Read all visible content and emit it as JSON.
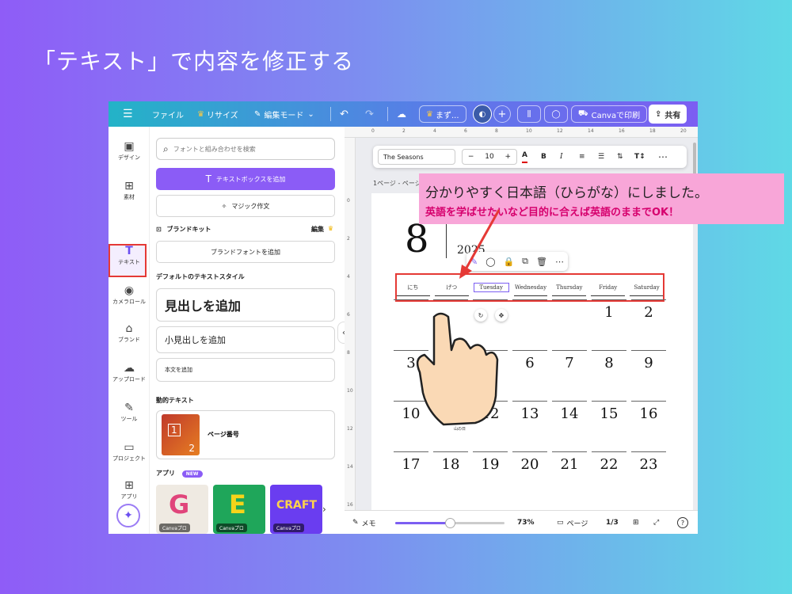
{
  "slide": {
    "title": "「テキスト」で内容を修正する"
  },
  "topbar": {
    "menu_icon": "hamburger-icon",
    "file": "ファイル",
    "resize": "リサイズ",
    "edit_mode": "編集モード",
    "doc_title": "まず...",
    "print": "Canvaで印刷",
    "share": "共有"
  },
  "rail": {
    "items": [
      {
        "label": "デザイン",
        "icon": "design-icon"
      },
      {
        "label": "素材",
        "icon": "elements-icon"
      },
      {
        "label": "テキスト",
        "icon": "text-icon"
      },
      {
        "label": "カメラロール",
        "icon": "camera-icon"
      },
      {
        "label": "ブランド",
        "icon": "brand-icon"
      },
      {
        "label": "アップロード",
        "icon": "upload-icon"
      },
      {
        "label": "ツール",
        "icon": "tools-icon"
      },
      {
        "label": "プロジェクト",
        "icon": "folder-icon"
      },
      {
        "label": "アプリ",
        "icon": "apps-icon"
      }
    ]
  },
  "panel": {
    "search_placeholder": "フォントと組み合わせを検索",
    "add_textbox": "テキストボックスを追加",
    "magic_write": "マジック作文",
    "brand_kit": "ブランドキット",
    "brand_edit": "編集",
    "add_brand_font": "ブランドフォントを追加",
    "default_styles": "デフォルトのテキストスタイル",
    "heading": "見出しを追加",
    "subheading": "小見出しを追加",
    "body": "本文を追加",
    "dynamic_text": "動的テキスト",
    "page_number": "ページ番号",
    "apps": "アプリ",
    "new_badge": "NEW",
    "app_badge": "Canvaプロ",
    "app_tiles": [
      "G",
      "E",
      "CRAFT"
    ]
  },
  "canvas": {
    "ruler_marks": [
      "0",
      "2",
      "4",
      "6",
      "8",
      "10",
      "12",
      "14",
      "16",
      "18",
      "20"
    ],
    "ruler_left": [
      "0",
      "2",
      "4",
      "6",
      "8",
      "10",
      "12",
      "14",
      "16",
      "18"
    ],
    "font": "The Seasons",
    "font_size": "10",
    "page_label": "1ページ - ページ...",
    "month": "8",
    "year": "2025",
    "weekdays": [
      "にち",
      "げつ",
      "Tuesday",
      "Wednesday",
      "Thursday",
      "Friday",
      "Saturday"
    ],
    "days": [
      [
        "",
        "",
        "",
        "",
        "",
        "1",
        "2"
      ],
      [
        "3",
        "",
        "",
        "6",
        "7",
        "8",
        "9"
      ],
      [
        "10",
        "11",
        "12",
        "13",
        "14",
        "15",
        "16"
      ],
      [
        "17",
        "18",
        "19",
        "20",
        "21",
        "22",
        "23"
      ]
    ],
    "holiday_label": "山の日"
  },
  "bottombar": {
    "memo": "メモ",
    "zoom": "73%",
    "zoom_level": 0.5,
    "pages": "ページ",
    "page_count": "1/3"
  },
  "callout": {
    "line1": "分かりやすく日本語（ひらがな）にしました。",
    "line2": "英語を学ばせたいなど目的に合えば英語のままでOK！"
  },
  "colors": {
    "accent": "#8b5cf6",
    "highlight_red": "#e53935",
    "callout_bg": "#f8a6d8",
    "callout_text": "#d6006d"
  }
}
